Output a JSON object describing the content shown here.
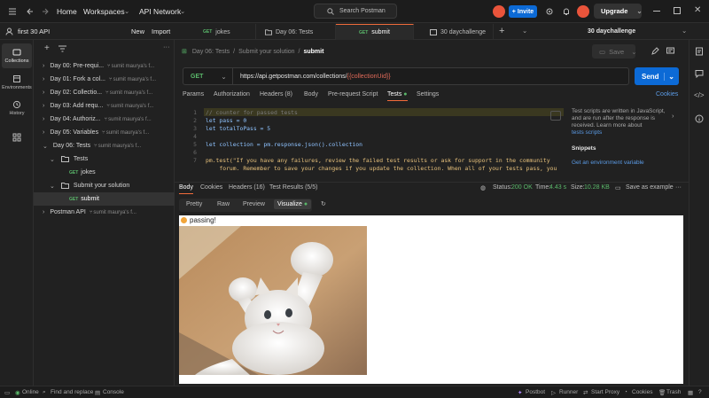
{
  "topbar": {
    "home": "Home",
    "workspaces": "Workspaces",
    "api_network": "API Network",
    "search_placeholder": "Search Postman",
    "invite": "Invite",
    "upgrade": "Upgrade"
  },
  "workspace": {
    "name": "first 30 API",
    "new": "New",
    "import": "Import"
  },
  "rail": [
    {
      "label": "Collections",
      "icon": "collections-icon"
    },
    {
      "label": "Environments",
      "icon": "environments-icon"
    },
    {
      "label": "History",
      "icon": "history-icon"
    },
    {
      "label": "",
      "icon": "apps-icon"
    }
  ],
  "tree": [
    {
      "label": "Day 00: Pre-requi...",
      "fork": "sumit maurya's f..."
    },
    {
      "label": "Day 01: Fork a col...",
      "fork": "sumit maurya's f..."
    },
    {
      "label": "Day 02: Collectio...",
      "fork": "sumit maurya's f..."
    },
    {
      "label": "Day 03: Add requ...",
      "fork": "sumit maurya's f..."
    },
    {
      "label": "Day 04: Authoriz...",
      "fork": "sumit maurya's f..."
    },
    {
      "label": "Day 05: Variables",
      "fork": "sumit maurya's f..."
    },
    {
      "label": "Day 06: Tests",
      "fork": "sumit maurya's f..."
    },
    {
      "label": "Tests"
    },
    {
      "method": "GET",
      "label": "jokes"
    },
    {
      "label": "Submit your solution"
    },
    {
      "method": "GET",
      "label": "submit"
    },
    {
      "label": "Postman API",
      "fork": "sumit maurya's f..."
    }
  ],
  "tabs": [
    {
      "method": "GET",
      "label": "jokes"
    },
    {
      "method": "",
      "label": "Day 06: Tests"
    },
    {
      "method": "GET",
      "label": "submit"
    },
    {
      "method": "",
      "label": "30 daychallenge"
    }
  ],
  "env_selector": "30 daychallenge",
  "breadcrumb": {
    "a": "Day 06: Tests",
    "sep": "/",
    "b": "Submit your solution",
    "c": "submit"
  },
  "save": "Save",
  "request": {
    "method": "GET",
    "url_prefix": "https://api.getpostman.com/collections/",
    "url_var": "{{collectionUid}}",
    "send": "Send"
  },
  "request_tabs": [
    "Params",
    "Authorization",
    "Headers (8)",
    "Body",
    "Pre-request Script",
    "Tests",
    "Settings"
  ],
  "cookies": "Cookies",
  "code": [
    {
      "n": "1",
      "t": "// counter for passed tests"
    },
    {
      "n": "2",
      "t": "let pass = 0"
    },
    {
      "n": "3",
      "t": "let totalToPass = 5"
    },
    {
      "n": "4",
      "t": ""
    },
    {
      "n": "5",
      "t": "let collection = pm.response.json().collection"
    },
    {
      "n": "6",
      "t": ""
    },
    {
      "n": "7",
      "t": "pm.test(\"If you have any failures, review the failed test results or ask for support in the community"
    },
    {
      "n": "",
      "t": "    forum. Remember to save your changes if you update the collection. When all of your tests pass, you"
    }
  ],
  "help": {
    "text": "Test scripts are written in JavaScript, and are run after the response is received. Learn more about",
    "link": "tests scripts",
    "snippets": "Snippets",
    "snippet1": "Get an environment variable"
  },
  "response": {
    "tabs": [
      "Body",
      "Cookies",
      "Headers (16)",
      "Test Results (5/5)"
    ],
    "status_label": "Status:",
    "status": "200 OK",
    "time_label": "Time:",
    "time": "4.43 s",
    "size_label": "Size:",
    "size": "10.28 KB",
    "save_example": "Save as example",
    "view_tabs": [
      "Pretty",
      "Raw",
      "Preview",
      "Visualize"
    ],
    "passing": "passing!"
  },
  "statusbar": {
    "online": "Online",
    "find": "Find and replace",
    "console": "Console",
    "postbot": "Postbot",
    "runner": "Runner",
    "proxy": "Start Proxy",
    "cookies": "Cookies",
    "trash": "Trash"
  },
  "colors": {
    "accent": "#0c6ad6",
    "get": "#5ab86a",
    "status_ok": "#5ab86a",
    "var": "#e36b5a",
    "tab_active": "#f26b3a"
  }
}
